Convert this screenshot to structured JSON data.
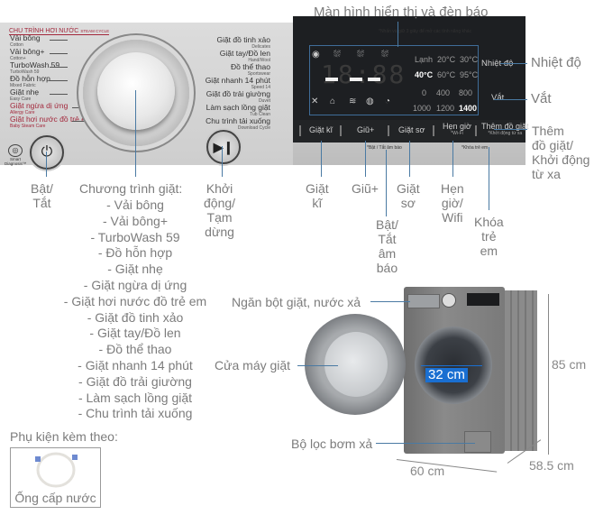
{
  "panel": {
    "section_title": "CHU TRÌNH HƠI NƯỚC",
    "section_title_sub": "STEAM CYCLE",
    "programs_left": [
      {
        "name": "Vải bông",
        "sub": "Cotton",
        "highlight": false
      },
      {
        "name": "Vải bông+",
        "sub": "Cotton+",
        "highlight": false
      },
      {
        "name": "TurboWash 59",
        "sub": "TurboWash 59",
        "highlight": false
      },
      {
        "name": "Đồ hỗn hợp",
        "sub": "Mixed Fabric",
        "highlight": false
      },
      {
        "name": "Giặt nhẹ",
        "sub": "Easy Care",
        "highlight": false
      },
      {
        "name": "Giặt ngừa dị ứng",
        "sub": "Allergy Care",
        "highlight": true
      },
      {
        "name": "Giặt hơi nước đồ trẻ em",
        "sub": "Baby Steam Care",
        "highlight": true
      }
    ],
    "programs_right": [
      {
        "name": "Giặt đồ tinh xảo",
        "sub": "Delicates"
      },
      {
        "name": "Giặt tay/Đồ len",
        "sub": "Hand/Wool"
      },
      {
        "name": "Đồ thể thao",
        "sub": "Sportswear"
      },
      {
        "name": "Giặt nhanh 14 phút",
        "sub": "Speed 14"
      },
      {
        "name": "Giặt đồ trải giường",
        "sub": "Duvet"
      },
      {
        "name": "Làm sạch lồng giặt",
        "sub": "Tub Clean"
      },
      {
        "name": "Chu trình tải xuống",
        "sub": "Download Cycle"
      }
    ],
    "smart_diagnosis": "Smart Diagnosis™",
    "display_note": "*Nhấn và giữ 3 giây để mở các tính năng khác",
    "display": {
      "digits": "18:88",
      "temps": [
        {
          "label": "Lạnh",
          "active": false
        },
        {
          "label": "20°C",
          "active": false
        },
        {
          "label": "30°C",
          "active": false
        },
        {
          "label": "40°C",
          "active": true
        },
        {
          "label": "60°C",
          "active": false
        },
        {
          "label": "95°C",
          "active": false
        }
      ],
      "spins": [
        {
          "label": "0",
          "active": false
        },
        {
          "label": "400",
          "active": false
        },
        {
          "label": "800",
          "active": false
        },
        {
          "label": "1000",
          "active": false
        },
        {
          "label": "1200",
          "active": false
        },
        {
          "label": "1400",
          "active": true
        }
      ],
      "temp_button": "Nhiệt độ",
      "spin_button": "Vắt"
    },
    "buttons": [
      {
        "label": "Giặt kĩ",
        "sub": ""
      },
      {
        "label": "Giũ+",
        "sub": ""
      },
      {
        "label": "Giặt sơ",
        "sub": ""
      },
      {
        "label": "Hẹn giờ",
        "sub": "*Wi-Fi"
      },
      {
        "label": "Thêm đồ giặt",
        "sub": "*Khởi động từ xa"
      }
    ],
    "under_notes": {
      "sound": "*Bật / Tắt âm báo",
      "child_lock": "*Khóa trẻ em"
    }
  },
  "callouts": {
    "display_indicator": "Màn hình hiển thị và đèn báo",
    "temperature": "Nhiệt độ",
    "spin": "Vắt",
    "add_item": "Thêm\nđồ giặt/\nKhởi động\ntừ xa",
    "power": "Bật/\nTắt",
    "programs_title": "Chương trình giặt:",
    "programs": [
      "- Vải bông",
      "- Vải bông+",
      "- TurboWash 59",
      "- Đồ hỗn hợp",
      "- Giặt nhẹ",
      "- Giặt ngừa dị ứng",
      "- Giặt hơi nước đồ trẻ em",
      "- Giặt đồ tinh xảo",
      "- Giặt tay/Đồ len",
      "- Đồ thể thao",
      "- Giặt nhanh 14 phút",
      "- Giặt đồ trải giường",
      "- Làm sạch lồng giặt",
      "- Chu trình tải xuống"
    ],
    "start_pause": "Khởi\nđộng/\nTạm\ndừng",
    "intensive": "Giặt\nkĩ",
    "rinse_plus": "Giũ+",
    "sound_toggle": "Bật/\nTắt\nâm\nbáo",
    "pre_wash": "Giặt\nsơ",
    "timer_wifi": "Hẹn\ngiờ/\nWifi",
    "child_lock": "Khóa\ntrẻ\nem",
    "detergent_drawer": "Ngăn bột giặt, nước xả",
    "door": "Cửa máy giặt",
    "drain_filter": "Bộ lọc bơm xả",
    "door_diameter": "32 cm",
    "height": "85 cm",
    "width": "60 cm",
    "depth": "58.5 cm"
  },
  "accessories": {
    "title": "Phụ kiện kèm theo:",
    "items": [
      {
        "label": "Ống cấp nước"
      }
    ]
  },
  "colors": {
    "callout_line": "#4a7aa3",
    "label_text": "#7c7c7c",
    "highlight_program": "#a3283c",
    "badge_blue": "#1a6fd1"
  }
}
